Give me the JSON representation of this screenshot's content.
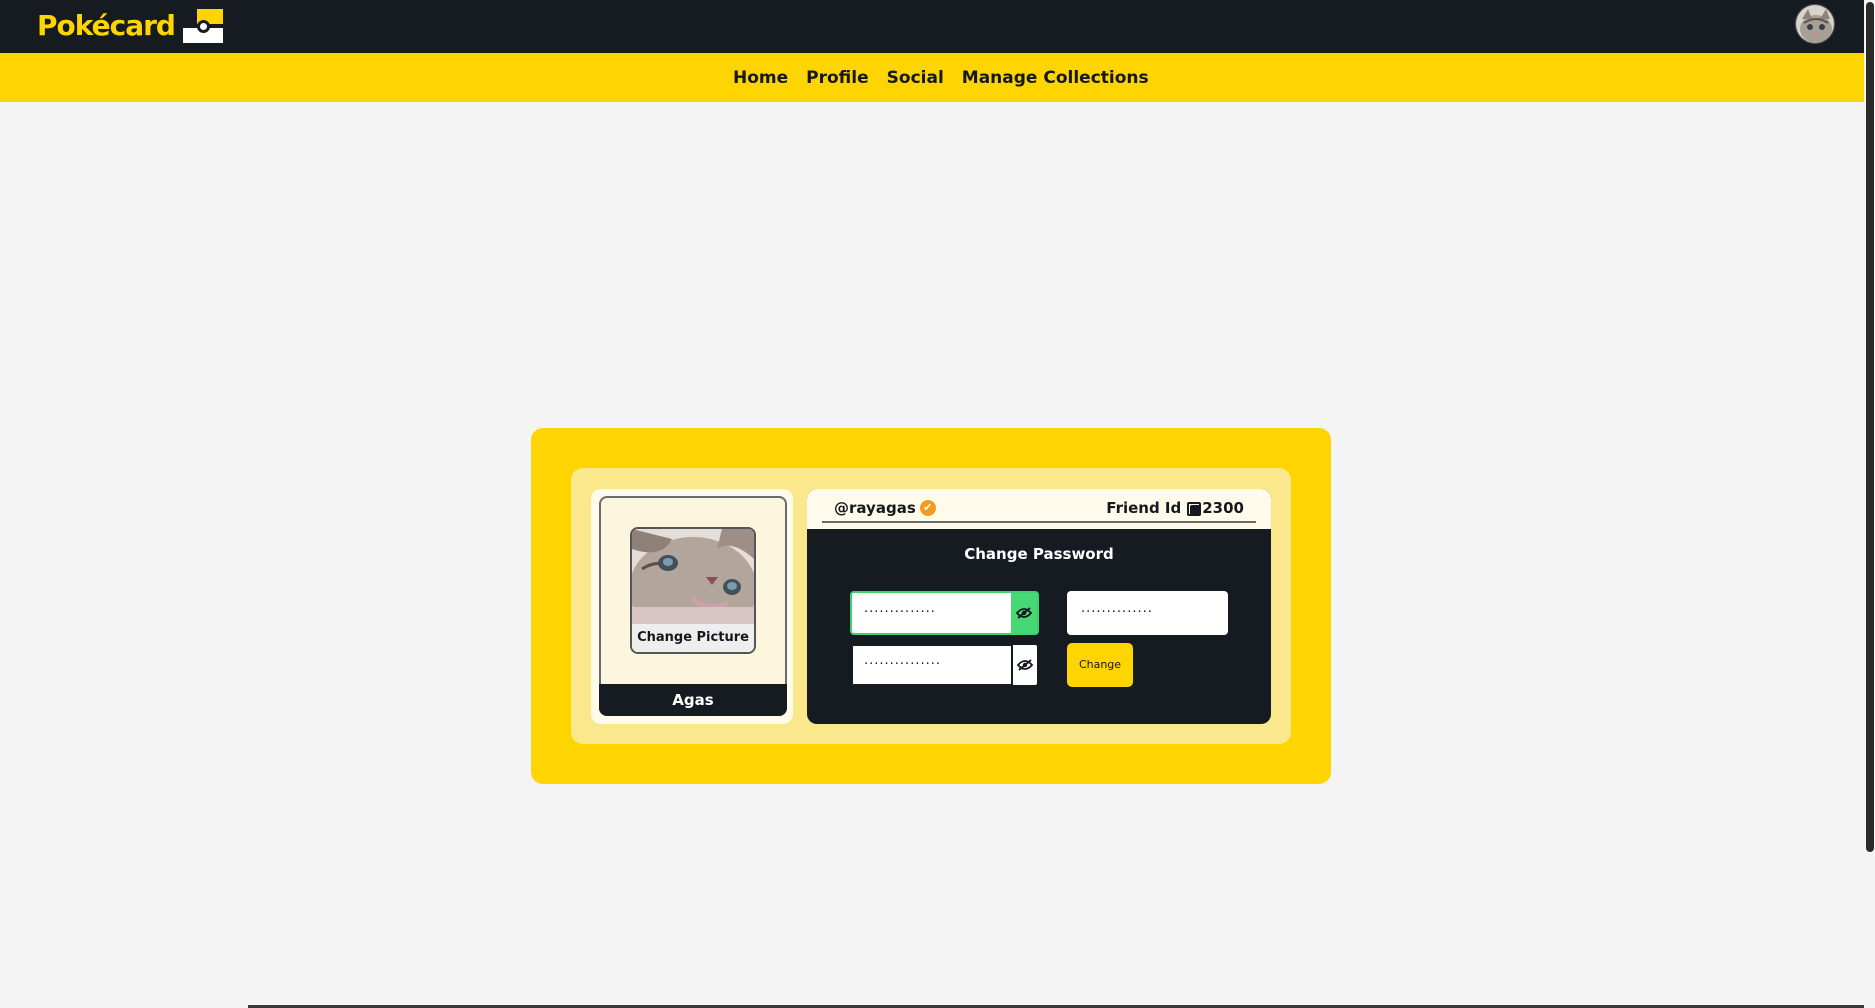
{
  "header": {
    "logo_text": "Pokécard",
    "avatar_alt": "cat avatar"
  },
  "nav": {
    "items": [
      {
        "label": "Home"
      },
      {
        "label": "Profile"
      },
      {
        "label": "Social"
      },
      {
        "label": "Manage Collections"
      }
    ]
  },
  "profile_card": {
    "change_picture_label": "Change Picture",
    "display_name": "Agas"
  },
  "panel": {
    "handle": "@rayagas",
    "friend_id_label": "Friend Id",
    "friend_id_value": "2300",
    "title": "Change Password",
    "old_password_value": "··············",
    "new_password_value": "··············",
    "confirm_password_value": "···············",
    "change_button_label": "Change"
  },
  "colors": {
    "brand_yellow": "#fed401",
    "dark": "#161a21",
    "success_green": "#45d874",
    "verified_orange": "#f39a21"
  }
}
